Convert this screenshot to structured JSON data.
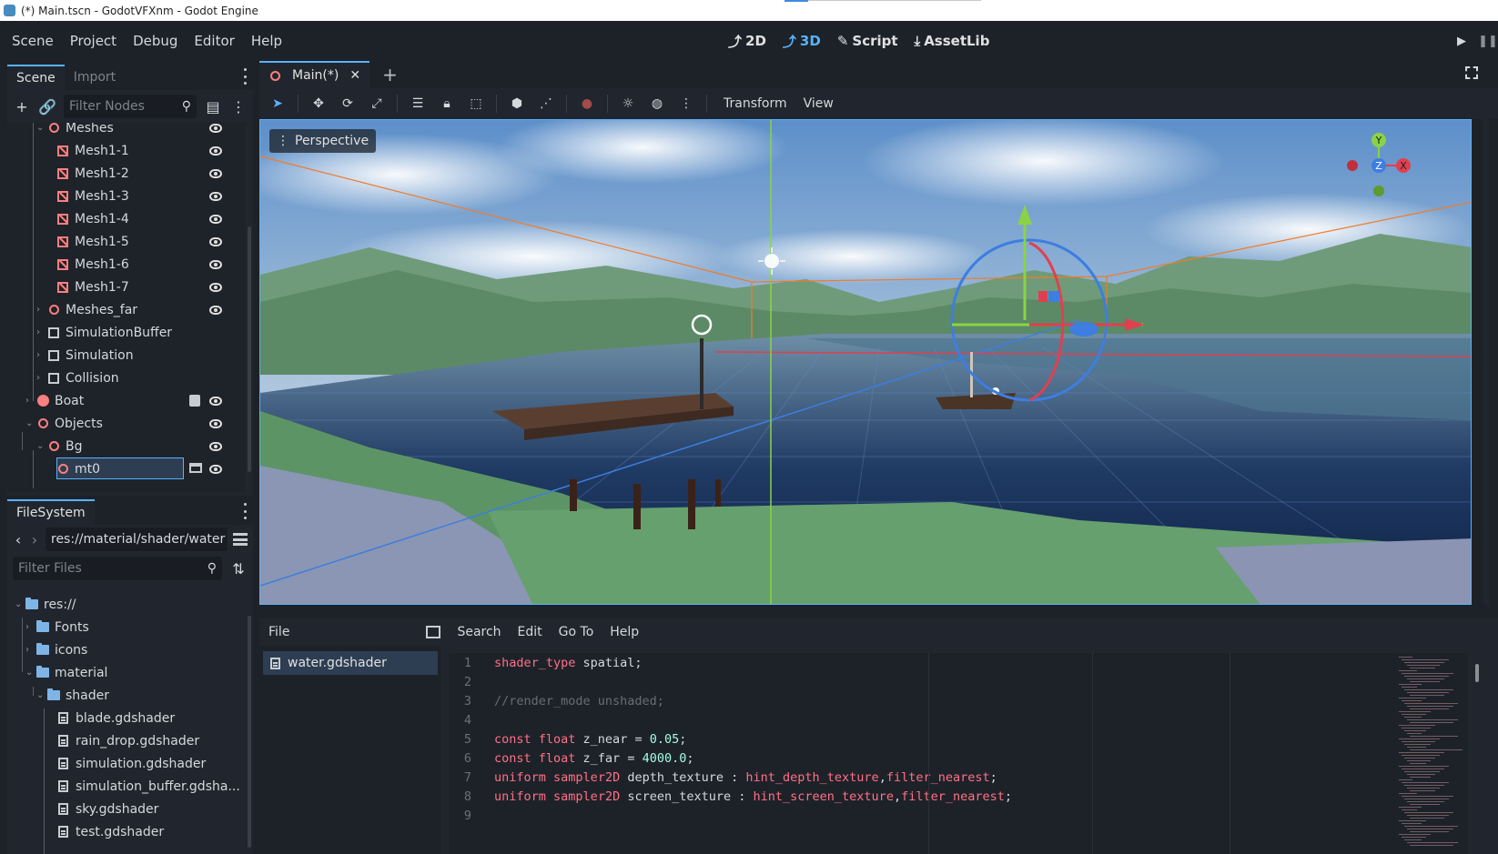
{
  "window": {
    "title": "(*) Main.tscn - GodotVFXnm - Godot Engine"
  },
  "menu": [
    "Scene",
    "Project",
    "Debug",
    "Editor",
    "Help"
  ],
  "main_screens": [
    {
      "label": "2D",
      "icon": "2d-icon",
      "active": false
    },
    {
      "label": "3D",
      "icon": "3d-icon",
      "active": true
    },
    {
      "label": "Script",
      "icon": "script-icon",
      "active": false
    },
    {
      "label": "AssetLib",
      "icon": "assetlib-icon",
      "active": false
    }
  ],
  "scene_dock": {
    "tabs": [
      "Scene",
      "Import"
    ],
    "filter_placeholder": "Filter Nodes",
    "tree": [
      {
        "label": "Meshes",
        "icon": "node3d",
        "expanded": true
      },
      {
        "label": "Mesh1-1",
        "icon": "mesh"
      },
      {
        "label": "Mesh1-2",
        "icon": "mesh"
      },
      {
        "label": "Mesh1-3",
        "icon": "mesh"
      },
      {
        "label": "Mesh1-4",
        "icon": "mesh"
      },
      {
        "label": "Mesh1-5",
        "icon": "mesh"
      },
      {
        "label": "Mesh1-6",
        "icon": "mesh"
      },
      {
        "label": "Mesh1-7",
        "icon": "mesh"
      },
      {
        "label": "Meshes_far",
        "icon": "node3d"
      },
      {
        "label": "SimulationBuffer",
        "icon": "subviewport"
      },
      {
        "label": "Simulation",
        "icon": "subviewport"
      },
      {
        "label": "Collision",
        "icon": "subviewport"
      },
      {
        "label": "Boat",
        "icon": "boat"
      },
      {
        "label": "Objects",
        "icon": "node3d"
      },
      {
        "label": "Bg",
        "icon": "node3d"
      },
      {
        "label": "mt0",
        "icon": "node3d",
        "selected": true
      }
    ]
  },
  "filesystem": {
    "tab": "FileSystem",
    "path": "res://material/shader/water",
    "filter_placeholder": "Filter Files",
    "tree": [
      {
        "label": "res://",
        "type": "folder"
      },
      {
        "label": "Fonts",
        "type": "folder"
      },
      {
        "label": "icons",
        "type": "folder"
      },
      {
        "label": "material",
        "type": "folder"
      },
      {
        "label": "shader",
        "type": "folder"
      },
      {
        "label": "blade.gdshader",
        "type": "file"
      },
      {
        "label": "rain_drop.gdshader",
        "type": "file"
      },
      {
        "label": "simulation.gdshader",
        "type": "file"
      },
      {
        "label": "simulation_buffer.gdsha...",
        "type": "file"
      },
      {
        "label": "sky.gdshader",
        "type": "file"
      },
      {
        "label": "test.gdshader",
        "type": "file"
      }
    ]
  },
  "editor": {
    "scene_tab": "Main(*)",
    "toolbar_menus": [
      "Transform",
      "View"
    ],
    "viewport_label": "Perspective",
    "gizmo": {
      "y": "Y",
      "z": "Z",
      "x": "X"
    }
  },
  "script_editor": {
    "menus": [
      "File",
      "Search",
      "Edit",
      "Go To",
      "Help"
    ],
    "open_file": "water.gdshader",
    "lines": [
      {
        "n": "1",
        "parts": [
          [
            "kw",
            "shader_type"
          ],
          [
            "pl",
            " spatial;"
          ]
        ]
      },
      {
        "n": "2",
        "parts": []
      },
      {
        "n": "3",
        "parts": [
          [
            "cm",
            "//render_mode unshaded;"
          ]
        ]
      },
      {
        "n": "4",
        "parts": []
      },
      {
        "n": "5",
        "parts": [
          [
            "kw",
            "const"
          ],
          [
            "pl",
            " "
          ],
          [
            "kw",
            "float"
          ],
          [
            "pl",
            " z_near = "
          ],
          [
            "num",
            "0.05"
          ],
          [
            "pl",
            ";"
          ]
        ]
      },
      {
        "n": "6",
        "parts": [
          [
            "kw",
            "const"
          ],
          [
            "pl",
            " "
          ],
          [
            "kw",
            "float"
          ],
          [
            "pl",
            " z_far = "
          ],
          [
            "num",
            "4000.0"
          ],
          [
            "pl",
            ";"
          ]
        ]
      },
      {
        "n": "7",
        "parts": [
          [
            "kw",
            "uniform"
          ],
          [
            "pl",
            " "
          ],
          [
            "kw",
            "sampler2D"
          ],
          [
            "pl",
            " depth_texture : "
          ],
          [
            "hint",
            "hint_depth_texture"
          ],
          [
            "pl",
            ","
          ],
          [
            "hint",
            "filter_nearest"
          ],
          [
            "pl",
            ";"
          ]
        ]
      },
      {
        "n": "8",
        "parts": [
          [
            "kw",
            "uniform"
          ],
          [
            "pl",
            " "
          ],
          [
            "kw",
            "sampler2D"
          ],
          [
            "pl",
            " screen_texture : "
          ],
          [
            "hint",
            "hint_screen_texture"
          ],
          [
            "pl",
            ","
          ],
          [
            "hint",
            "filter_nearest"
          ],
          [
            "pl",
            ";"
          ]
        ]
      },
      {
        "n": "9",
        "parts": []
      }
    ]
  },
  "colors": {
    "accent": "#57b3ff",
    "base": "#21262e",
    "dark": "#1d2229",
    "node_red": "#fc7f7f"
  }
}
